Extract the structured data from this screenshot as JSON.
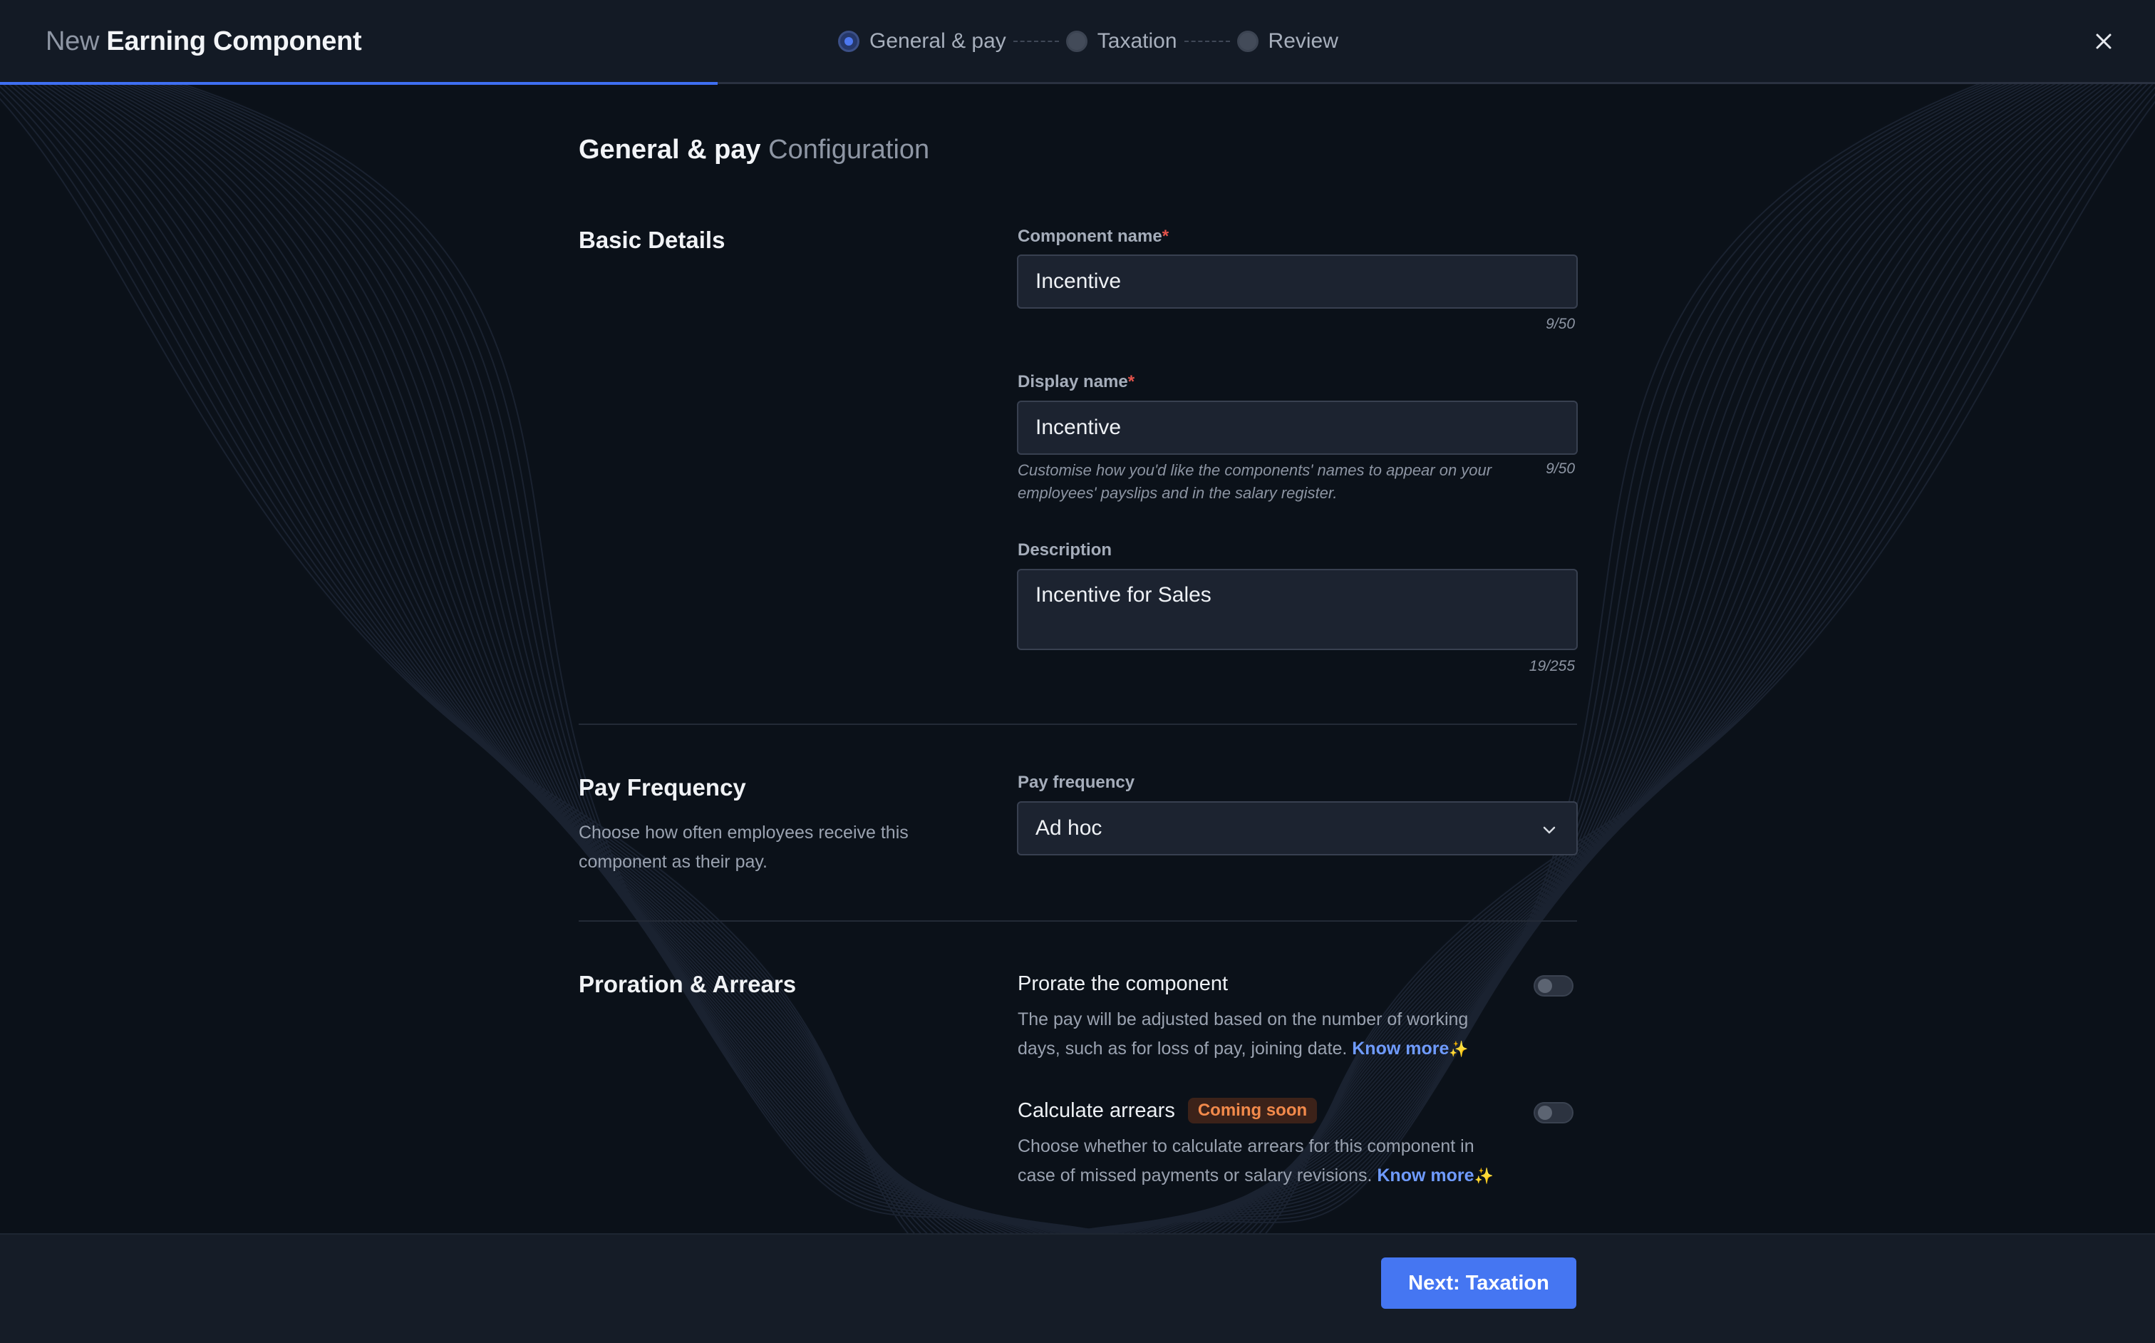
{
  "header": {
    "title_prefix": "New",
    "title_main": "Earning Component",
    "steps": [
      {
        "label": "General & pay",
        "state": "active"
      },
      {
        "label": "Taxation",
        "state": "pending"
      },
      {
        "label": "Review",
        "state": "pending"
      }
    ],
    "close_icon": "close-icon"
  },
  "page": {
    "heading_bold": "General & pay",
    "heading_light": "Configuration"
  },
  "basic_details": {
    "title": "Basic Details",
    "component_name": {
      "label": "Component name",
      "required_mark": "*",
      "value": "Incentive",
      "counter": "9/50"
    },
    "display_name": {
      "label": "Display name",
      "required_mark": "*",
      "value": "Incentive",
      "counter": "9/50",
      "helper": "Customise how you'd like the components' names to appear on your employees' payslips and in the salary register."
    },
    "description": {
      "label": "Description",
      "value": "Incentive for Sales",
      "counter": "19/255"
    }
  },
  "pay_frequency": {
    "title": "Pay Frequency",
    "desc": "Choose how often employees receive this component as their pay.",
    "label": "Pay frequency",
    "selected": "Ad hoc",
    "icon": "chevron-down-icon"
  },
  "proration": {
    "title": "Proration & Arrears",
    "prorate": {
      "title": "Prorate the component",
      "desc": "The pay will be adjusted based on the number of working days, such as for loss of pay, joining date.",
      "link": "Know more",
      "enabled": false
    },
    "arrears": {
      "title": "Calculate arrears",
      "badge": "Coming soon",
      "desc": "Choose whether to calculate arrears for this component in case of missed payments or salary revisions.",
      "link": "Know more",
      "enabled": false
    }
  },
  "footer": {
    "next_label": "Next: Taxation"
  },
  "colors": {
    "accent": "#4576f2",
    "background": "#0b1119",
    "badge_text": "#f28a4b",
    "link": "#6f9bff"
  }
}
